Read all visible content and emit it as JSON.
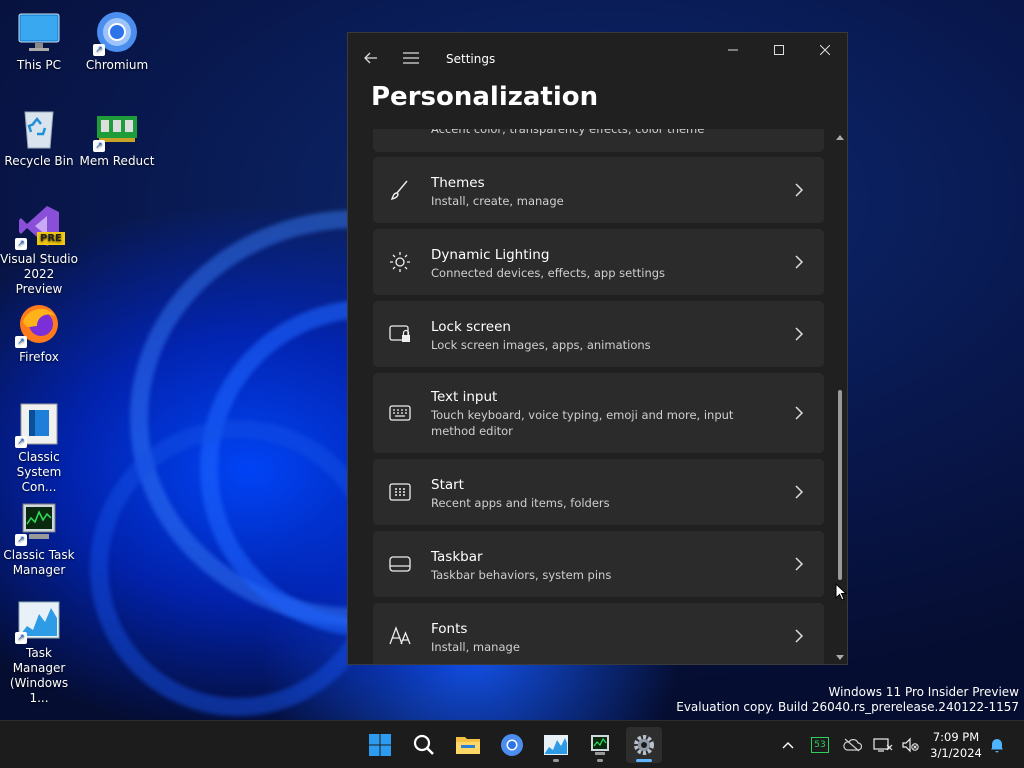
{
  "desktop": {
    "icons": [
      {
        "label": "This PC"
      },
      {
        "label": "Chromium"
      },
      {
        "label": "Recycle Bin"
      },
      {
        "label": "Mem Reduct"
      },
      {
        "label": "Visual Studio 2022 Preview",
        "badge": "PRE"
      },
      {
        "label": "Firefox"
      },
      {
        "label": "Classic System Con..."
      },
      {
        "label": "Classic Task Manager"
      },
      {
        "label": "Task Manager (Windows 1..."
      }
    ],
    "watermark_line1": "Windows 11 Pro Insider Preview",
    "watermark_line2": "Evaluation copy. Build 26040.rs_prerelease.240122-1157"
  },
  "settings": {
    "app_title": "Settings",
    "page_title": "Personalization",
    "items": [
      {
        "title": "",
        "subtitle": "Accent color, transparency effects, color theme",
        "icon": "palette-icon"
      },
      {
        "title": "Themes",
        "subtitle": "Install, create, manage",
        "icon": "brush-icon"
      },
      {
        "title": "Dynamic Lighting",
        "subtitle": "Connected devices, effects, app settings",
        "icon": "lighting-icon"
      },
      {
        "title": "Lock screen",
        "subtitle": "Lock screen images, apps, animations",
        "icon": "lock-screen-icon"
      },
      {
        "title": "Text input",
        "subtitle": "Touch keyboard, voice typing, emoji and more, input method editor",
        "icon": "keyboard-icon"
      },
      {
        "title": "Start",
        "subtitle": "Recent apps and items, folders",
        "icon": "start-grid-icon"
      },
      {
        "title": "Taskbar",
        "subtitle": "Taskbar behaviors, system pins",
        "icon": "taskbar-icon"
      },
      {
        "title": "Fonts",
        "subtitle": "Install, manage",
        "icon": "fonts-icon"
      }
    ]
  },
  "taskbar": {
    "apps": [
      "start-icon",
      "search-icon",
      "file-explorer-icon",
      "chromium-icon",
      "task-manager-icon",
      "classic-task-manager-icon",
      "settings-icon"
    ],
    "tray_badge": "53",
    "time": "7:09 PM",
    "date": "3/1/2024"
  },
  "colors": {
    "accent": "#0078d4",
    "window_bg": "#202020",
    "card_bg": "#2b2b2b"
  }
}
